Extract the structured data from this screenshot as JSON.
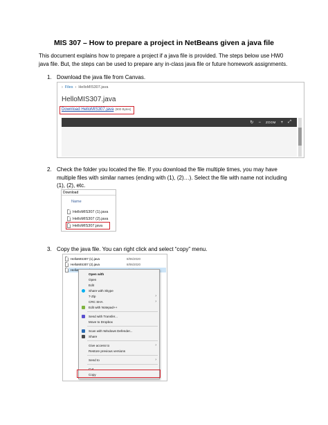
{
  "title": "MIS 307 – How to prepare a project in NetBeans given a java file",
  "intro": "This document explains how to prepare a project if a java file is provided. The steps below use HW0 java file. But, the steps can be used to prepare any in-class java file or future homework assignments.",
  "steps": [
    {
      "number": "1.",
      "text": "Download the java file from Canvas."
    },
    {
      "number": "2.",
      "text": "Check the folder you located the file. If you download the file multiple times, you may have multiple files with similar names (ending with (1), (2)…). Select the file with name not including (1), (2), etc."
    },
    {
      "number": "3.",
      "text": "Copy the java file. You can right click and select “copy” menu."
    }
  ],
  "shot1": {
    "breadcrumb_files": "Files",
    "breadcrumb_file": "HelloMIS307.java",
    "file_title": "HelloMIS307.java",
    "download_link": "Download HelloMIS307.java",
    "download_size": "(900 Bytes)",
    "toolbar": {
      "rotate": "↻",
      "zoom_out": "−",
      "zoom_label": "ZOOM",
      "zoom_in": "+",
      "fullscreen": "⤢"
    },
    "icons": [
      "chevron-right-icon",
      "rotate-icon",
      "zoom-out-icon",
      "zoom-in-icon",
      "fullscreen-icon"
    ]
  },
  "shot2": {
    "path": "Download",
    "column": "Name",
    "files": [
      "HelloMIS307 (1).java",
      "HelloMIS307 (2).java",
      "HelloMIS307.java"
    ],
    "icon": "java-file-icon"
  },
  "shot3": {
    "list": [
      {
        "name": "HelloMIS307 (1).java",
        "date": "8/06/2020"
      },
      {
        "name": "HelloMIS307 (2).java",
        "date": "8/06/2020"
      },
      {
        "name": "HelloMIS307.java",
        "date": "8/06/2020"
      }
    ],
    "menu": {
      "open_with_bold": "Open with",
      "open": "Open",
      "edit": "Edit",
      "share_skype": "Share with Skype",
      "zip": "7-Zip",
      "crc": "CRC SHA",
      "notepad": "Edit with Notepad++",
      "transfer": "Send with Transfer...",
      "dropbox": "Move to Dropbox",
      "defender": "Scan with Windows Defender...",
      "share": "Share",
      "give_access": "Give access to",
      "restore": "Restore previous versions",
      "send_to": "Send to",
      "cut": "Cut",
      "copy": "Copy",
      "submenu_arrow": "›"
    },
    "colors": {
      "skype": "#00aff0",
      "dropbox": "#0061fe",
      "defender": "#2b6cb3",
      "notepad": "#7fb33f",
      "share": "#4a4a4a",
      "transfer": "#5a4fcf"
    }
  },
  "colors": {
    "highlight_box": "#d0202a",
    "link": "#1f4fa8"
  }
}
